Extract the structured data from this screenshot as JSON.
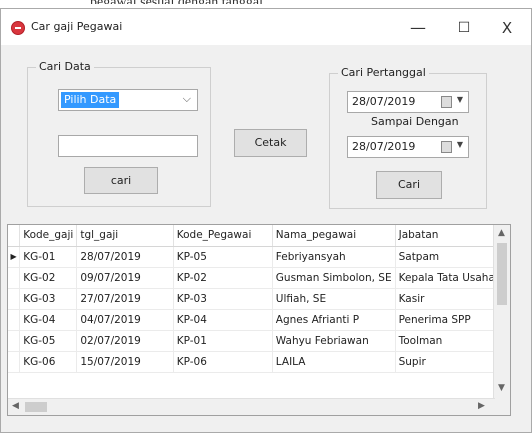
{
  "page_caption_fragment": "pegawai sesuai dengan tanggal",
  "window": {
    "title": "Car gaji Pegawai",
    "minimize_glyph": "—",
    "maximize_glyph": "☐",
    "close_glyph": "X"
  },
  "cari_data": {
    "group_label": "Cari Data",
    "combo_value": "Pilih Data",
    "text_value": "",
    "search_label": "cari"
  },
  "cetak_label": "Cetak",
  "cari_pertanggal": {
    "group_label": "Cari Pertanggal",
    "from_date": "28/07/2019",
    "until_label": "Sampai Dengan",
    "to_date": "28/07/2019",
    "search_label": "Cari"
  },
  "grid": {
    "columns": [
      "Kode_gaji",
      "tgl_gaji",
      "Kode_Pegawai",
      "Nama_pegawai",
      "Jabatan"
    ],
    "rows": [
      [
        "KG-01",
        "28/07/2019",
        "KP-05",
        "Febriyansyah",
        "Satpam"
      ],
      [
        "KG-02",
        "09/07/2019",
        "KP-02",
        "Gusman Simbolon, SE",
        "Kepala Tata Usaha"
      ],
      [
        "KG-03",
        "27/07/2019",
        "KP-03",
        "Ulfiah, SE",
        "Kasir"
      ],
      [
        "KG-04",
        "04/07/2019",
        "KP-04",
        "Agnes Afrianti P",
        "Penerima SPP"
      ],
      [
        "KG-05",
        "02/07/2019",
        "KP-01",
        "Wahyu Febriawan",
        "Toolman"
      ],
      [
        "KG-06",
        "15/07/2019",
        "KP-06",
        "LAILA",
        "Supir"
      ]
    ],
    "current_row_marker": "▶"
  },
  "colors": {
    "selection": "#3399ff",
    "window_bg": "#f0f0f0",
    "app_icon": "#d9363e"
  }
}
